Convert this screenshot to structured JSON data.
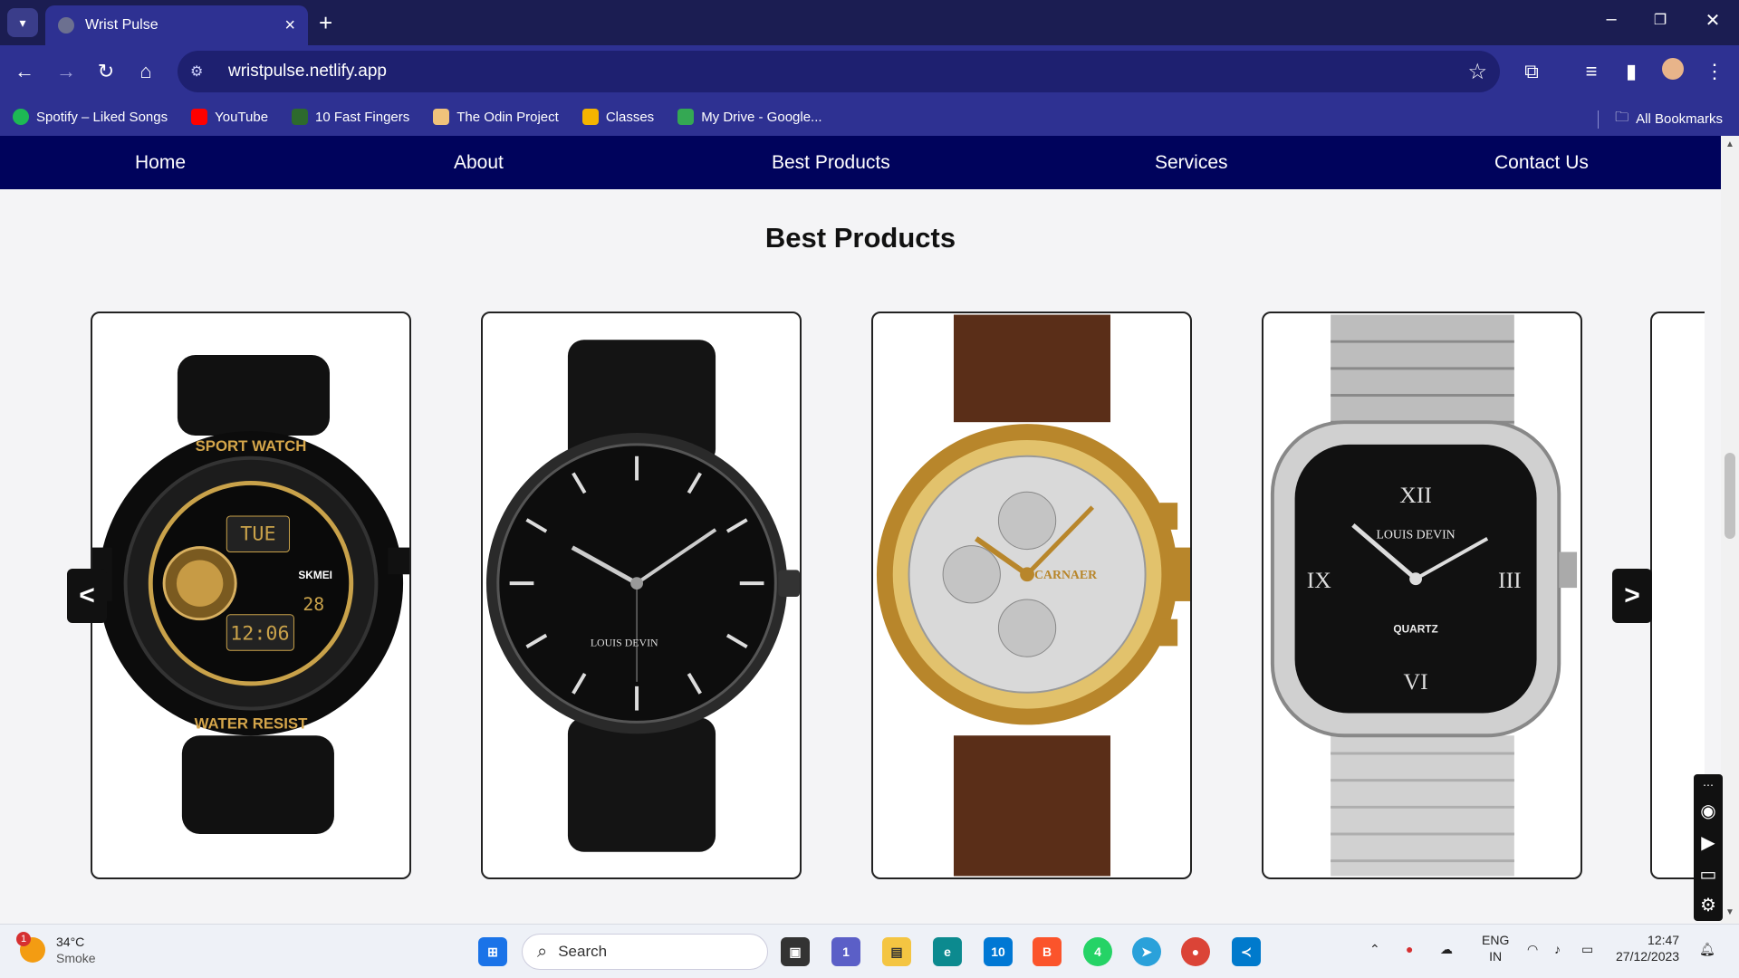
{
  "browser": {
    "tab_title": "Wrist Pulse",
    "url": "wristpulse.netlify.app",
    "bookmarks": [
      {
        "label": "Spotify – Liked Songs",
        "color": "#1db954"
      },
      {
        "label": "YouTube",
        "color": "#ff0000"
      },
      {
        "label": "10 Fast Fingers",
        "color": "#2d6a2d"
      },
      {
        "label": "The Odin Project",
        "color": "#f0c27b"
      },
      {
        "label": "Classes",
        "color": "#f4b400"
      },
      {
        "label": "My Drive - Google...",
        "color": "#34a853"
      }
    ],
    "all_bookmarks": "All Bookmarks"
  },
  "nav": {
    "items": [
      "Home",
      "About",
      "Best Products",
      "Services",
      "Contact Us"
    ]
  },
  "section": {
    "title": "Best Products"
  },
  "carousel": {
    "prev": "<",
    "next": ">",
    "products": [
      {
        "name": "sport-watch",
        "dial_text_top": "SPORT WATCH",
        "dial_text_bottom": "WATER RESIST",
        "brand": "SKMEI",
        "day": "TUE",
        "time": "12:06",
        "date": "28"
      },
      {
        "name": "louis-devin-black",
        "brand": "LOUIS DEVIN"
      },
      {
        "name": "carnaer-gold",
        "brand": "CARNAER"
      },
      {
        "name": "louis-devin-square",
        "brand": "LOUIS DEVIN",
        "sub": "QUARTZ"
      }
    ]
  },
  "taskbar": {
    "weather_temp": "34°C",
    "weather_desc": "Smoke",
    "weather_badge": "1",
    "search_placeholder": "Search",
    "lang_top": "ENG",
    "lang_bottom": "IN",
    "time": "12:47",
    "date": "27/12/2023",
    "badges": {
      "teams": "1",
      "mail": "10",
      "whatsapp": "4"
    }
  },
  "colors": {
    "nav_bg": "#00035c",
    "chrome_bg": "#2e3192",
    "titlebar_bg": "#1b1d52"
  }
}
